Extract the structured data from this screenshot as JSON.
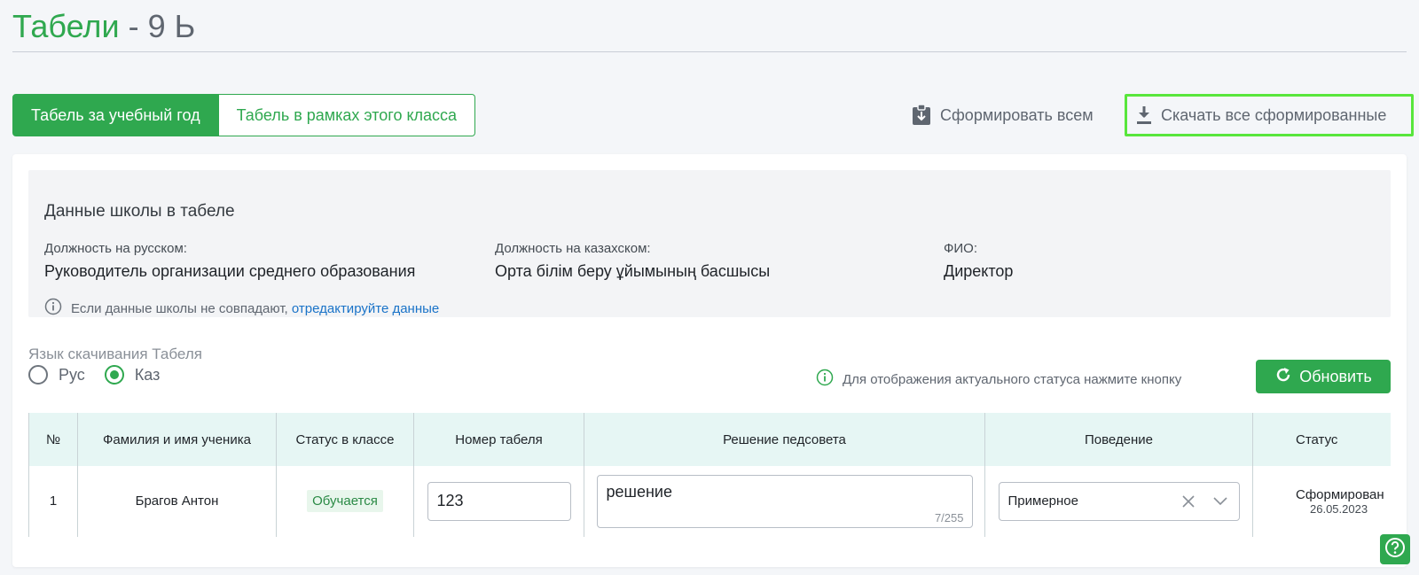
{
  "page": {
    "title_main": "Табели",
    "title_sep": " - ",
    "title_class": "9 Ь"
  },
  "tabs": [
    {
      "label": "Табель за учебный год",
      "active": true
    },
    {
      "label": "Табель в рамках этого класса",
      "active": false
    }
  ],
  "actions": {
    "form_all": "Сформировать всем",
    "download_all": "Скачать все сформированные"
  },
  "school": {
    "title": "Данные школы в табеле",
    "fields": [
      {
        "label": "Должность на русском:",
        "value": "Руководитель организации среднего образования"
      },
      {
        "label": "Должность на казахском:",
        "value": "Орта білім беру ұйымының басшысы"
      },
      {
        "label": "ФИО:",
        "value": "Директор"
      }
    ],
    "note_text": "Если данные школы не совпадают, ",
    "note_link": "отредактируйте данные"
  },
  "language": {
    "label": "Язык скачивания Табеля",
    "options": [
      {
        "label": "Рус",
        "checked": false
      },
      {
        "label": "Каз",
        "checked": true
      }
    ]
  },
  "status_hint": "Для отображения актуального статуса нажмите кнопку",
  "refresh_label": "Обновить",
  "table": {
    "headers": [
      "№",
      "Фамилия и имя ученика",
      "Статус в классе",
      "Номер табеля",
      "Решение педсовета",
      "Поведение",
      "Статус"
    ],
    "rows": [
      {
        "num": "1",
        "name": "Брагов Антон",
        "class_status": "Обучается",
        "report_number": "123",
        "decision": "решение",
        "decision_counter": "7/255",
        "behavior": "Примерное",
        "status": "Сформирован",
        "status_date": "26.05.2023"
      }
    ]
  },
  "colors": {
    "accent": "#2fa84f",
    "highlight_border": "#58e63c",
    "link": "#1a73c8",
    "table_header_bg": "#e6f6f4"
  }
}
